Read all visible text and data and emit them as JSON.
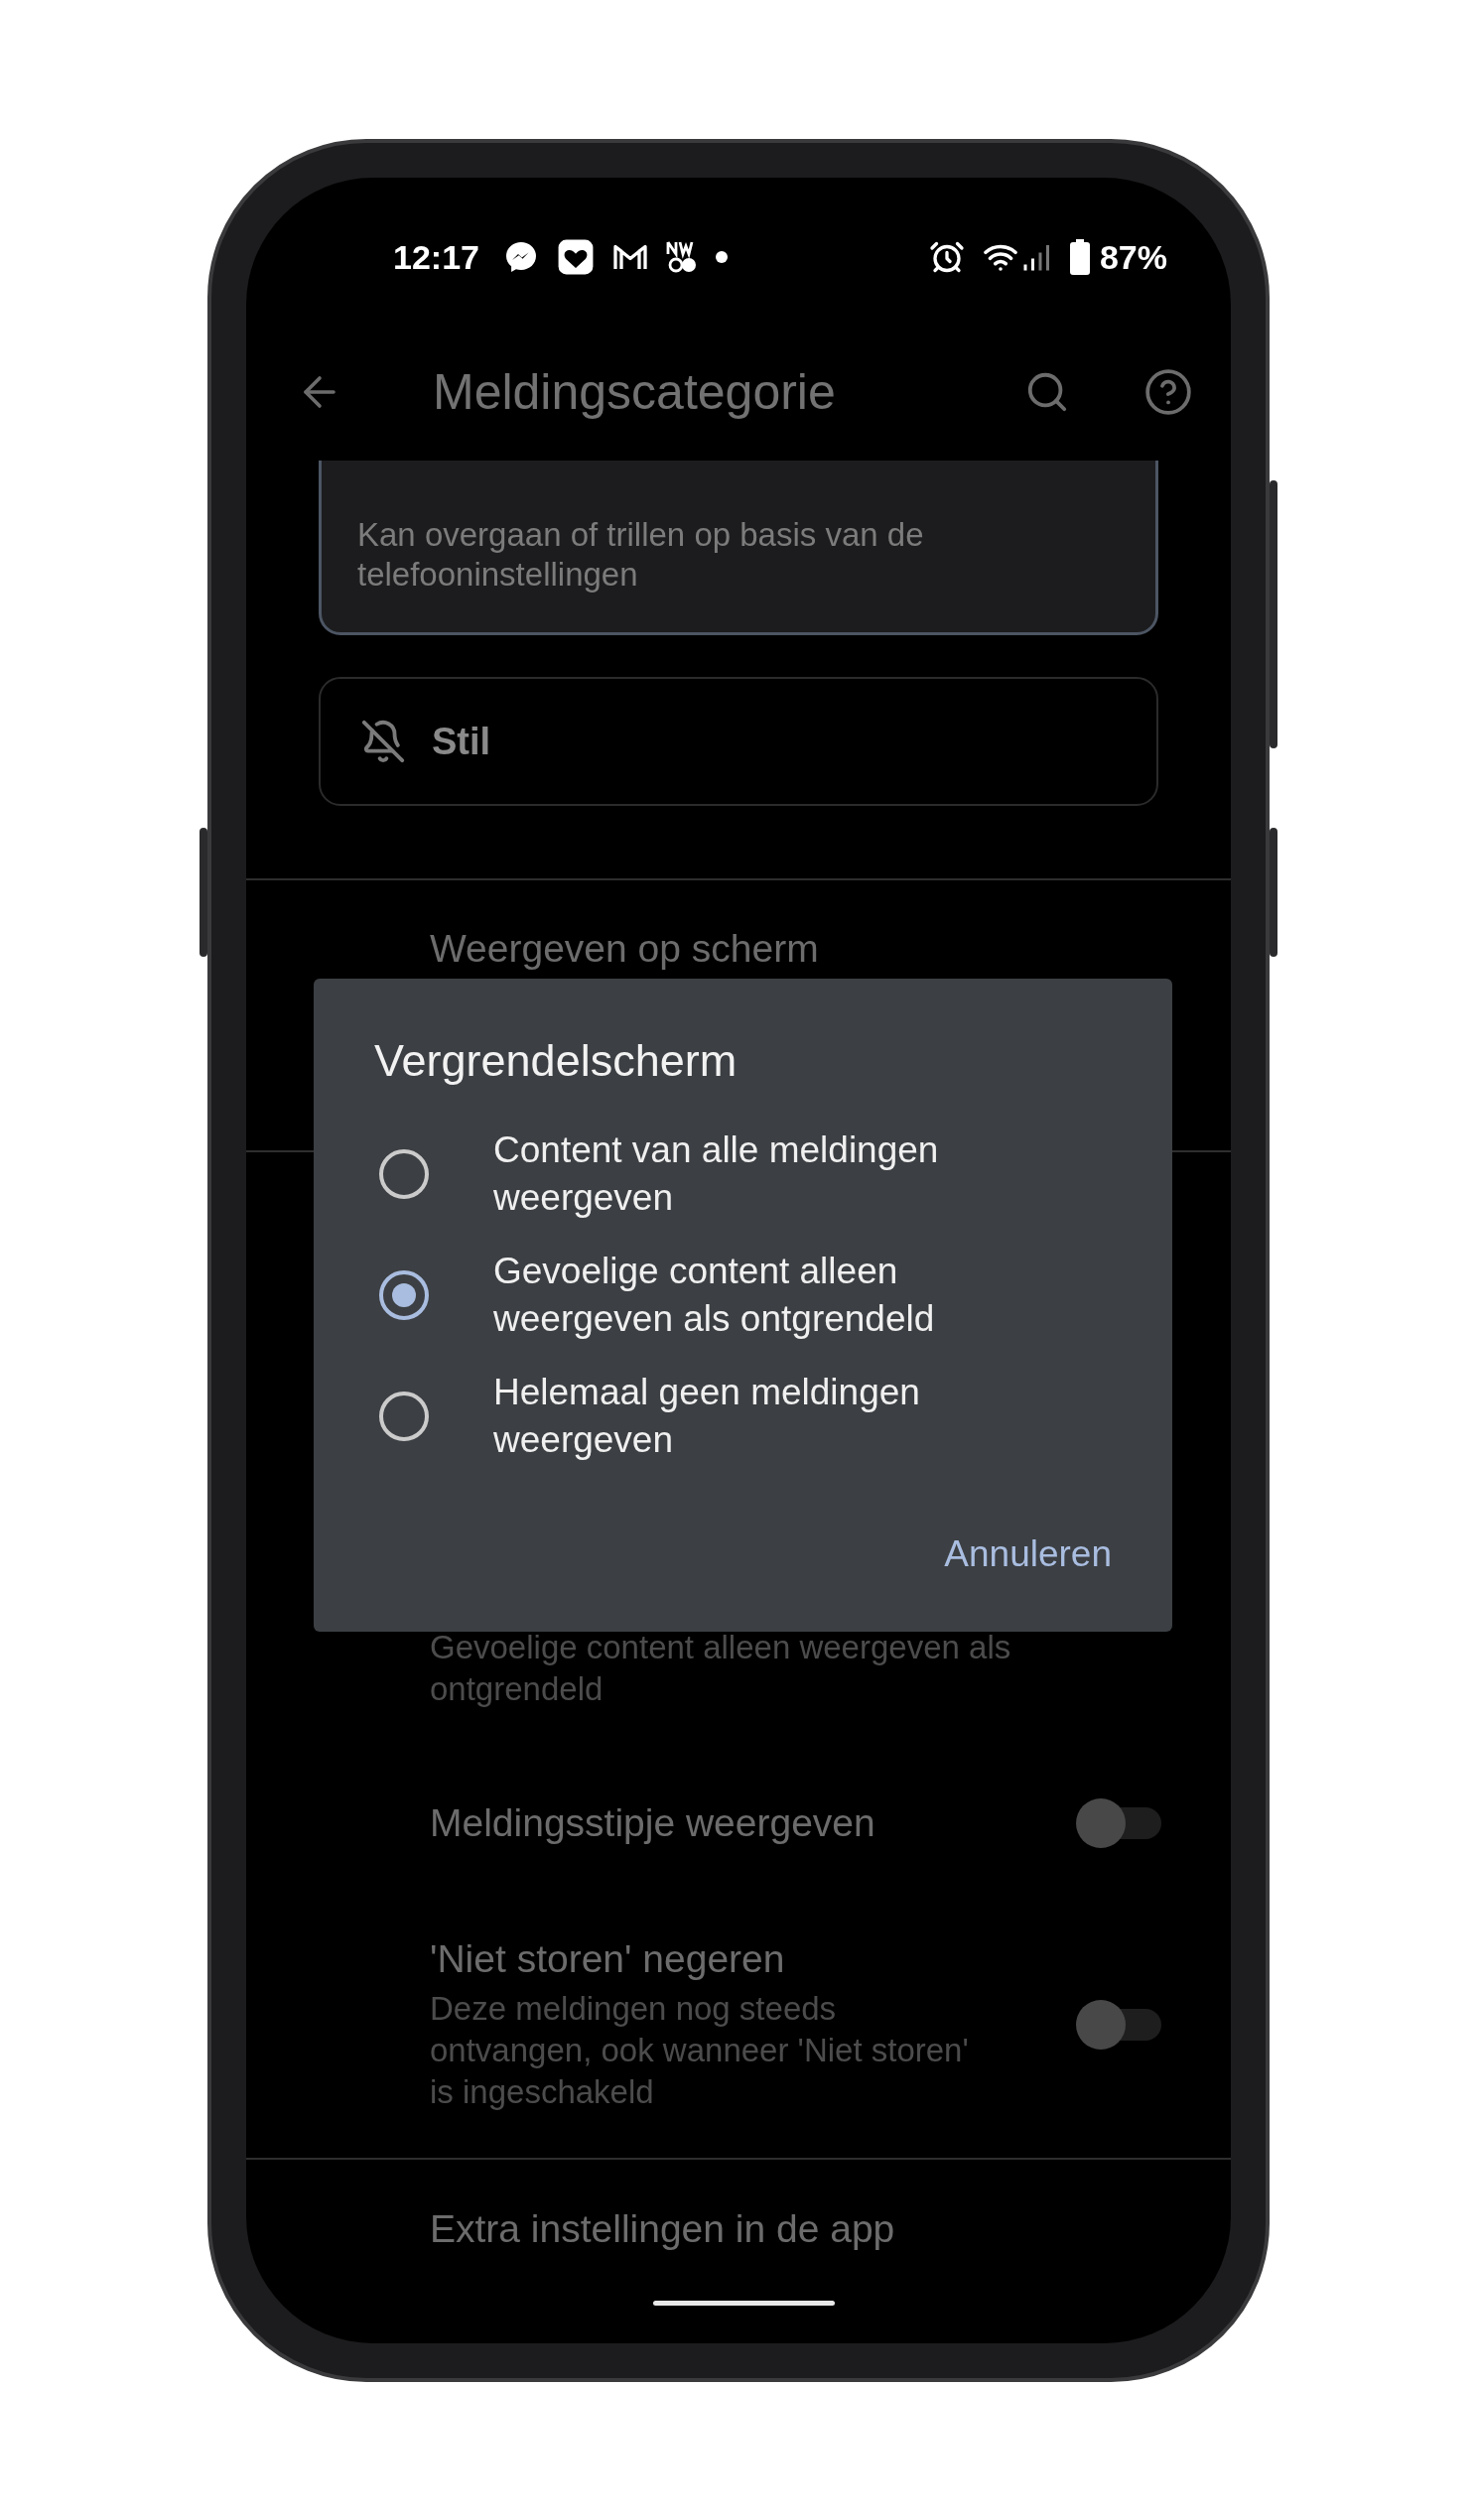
{
  "status_bar": {
    "time": "12:17",
    "battery": "87%"
  },
  "toolbar": {
    "title": "Meldingscategorie"
  },
  "behavior_options": [
    {
      "description": "Kan overgaan of trillen op basis van de telefooninstellingen",
      "selected": true
    },
    {
      "label": "Stil",
      "selected": false
    }
  ],
  "settings": [
    {
      "kind": "header",
      "title": "Weergeven op scherm",
      "divider_above": true
    },
    {
      "kind": "partial",
      "subtitle": "Gevoelige content alleen weergeven als ontgrendeld",
      "divider_above": true
    },
    {
      "kind": "toggle",
      "title": "Meldingsstipje weergeven",
      "on": false,
      "divider_above": false
    },
    {
      "kind": "toggle",
      "title": "'Niet storen' negeren",
      "subtitle": "Deze meldingen nog steeds ontvangen, ook wanneer 'Niet storen' is ingeschakeld",
      "on": false,
      "divider_above": false
    },
    {
      "kind": "link",
      "title": "Extra instellingen in de app",
      "divider_above": true
    }
  ],
  "dialog": {
    "title": "Vergrendelscherm",
    "options": [
      {
        "label": "Content van alle meldingen weergeven",
        "selected": false
      },
      {
        "label": "Gevoelige content alleen weergeven als ontgrendeld",
        "selected": true
      },
      {
        "label": "Helemaal geen meldingen weergeven",
        "selected": false
      }
    ],
    "buttons": [
      "Annuleren"
    ]
  }
}
